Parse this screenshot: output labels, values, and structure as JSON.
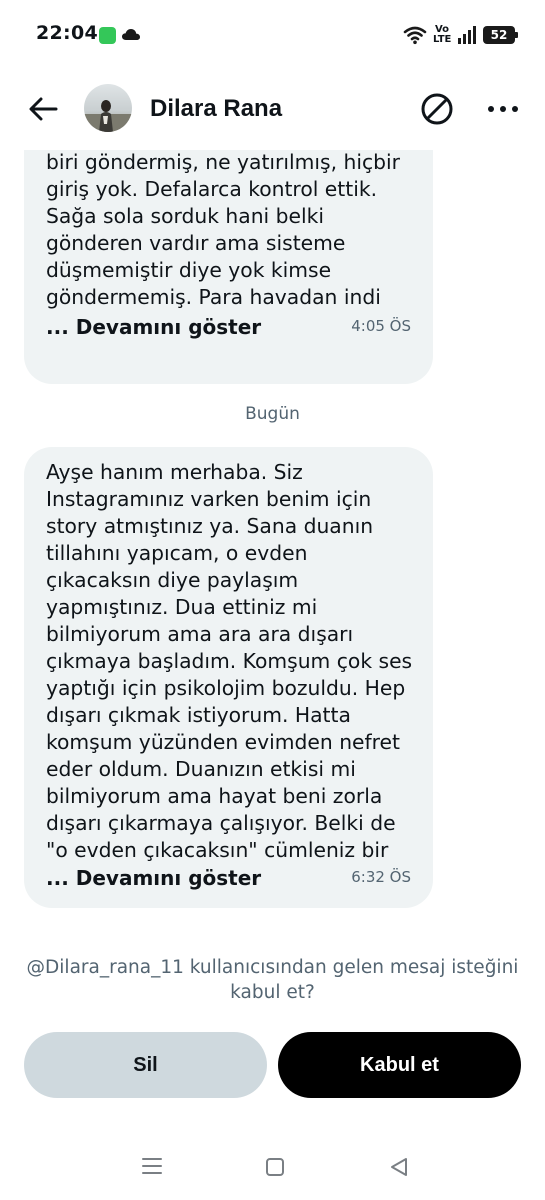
{
  "status_bar": {
    "time": "22:04",
    "volte_top": "Vo",
    "volte_bottom": "LTE",
    "battery": "52",
    "icons": [
      "app-notification-icon",
      "cloud-icon",
      "wifi-icon",
      "volte-icon",
      "signal-icon",
      "battery-icon"
    ]
  },
  "header": {
    "contact_name": "Dilara Rana",
    "icons": [
      "back-arrow-icon",
      "block-icon",
      "more-icon"
    ]
  },
  "messages": [
    {
      "text": "hareketlerinde de para girişi yok. Ne biri göndermiş, ne yatırılmış, hiçbir giriş yok. Defalarca kontrol ettik. Sağa sola sorduk hani belki gönderen vardır ama sisteme düşmemiştir diye yok kimse göndermemiş. Para havadan indi",
      "show_more": "... Devamını göster",
      "time": "4:05 ÖS"
    },
    {
      "text": "Ayşe hanım merhaba. Siz Instagramınız varken benim için story atmıştınız ya. Sana duanın tillahını yapıcam, o evden çıkacaksın diye paylaşım yapmıştınız. Dua ettiniz mi bilmiyorum ama ara ara dışarı çıkmaya başladım. Komşum çok ses yaptığı için psikolojim bozuldu. Hep dışarı çıkmak istiyorum. Hatta komşum yüzünden evimden nefret eder oldum. Duanızın etkisi mi bilmiyorum ama hayat beni zorla dışarı çıkarmaya çalışıyor. Belki de \"o evden çıkacaksın\" cümleniz bir",
      "show_more": "... Devamını göster",
      "time": "6:32 ÖS"
    }
  ],
  "day_divider": "Bugün",
  "request": {
    "text": "@Dilara_rana_11 kullanıcısından gelen mesaj isteğini kabul et?",
    "delete_label": "Sil",
    "accept_label": "Kabul et"
  },
  "colors": {
    "bubble": "#eff3f4",
    "secondary_text": "#536471",
    "delete_button": "#cfd9de",
    "accept_button": "#000000"
  }
}
